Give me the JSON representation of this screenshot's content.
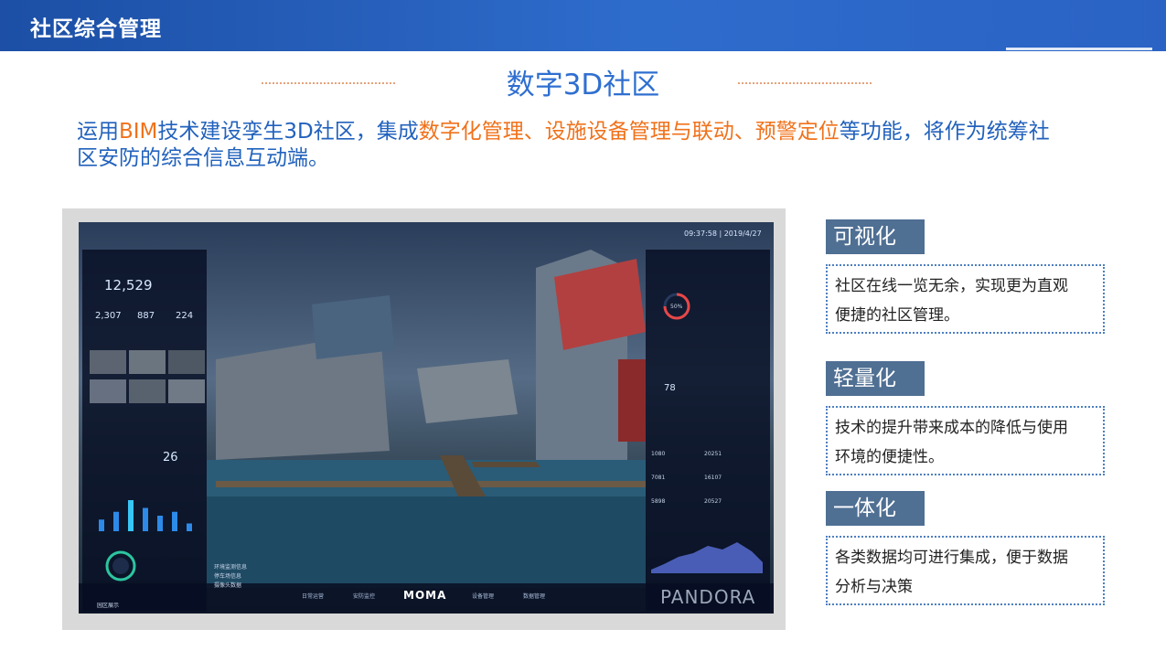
{
  "header": {
    "title": "社区综合管理"
  },
  "heading": "数字3D社区",
  "intro": {
    "parts": [
      {
        "text": "运用",
        "highlight": false
      },
      {
        "text": "BIM",
        "highlight": true
      },
      {
        "text": "技术建设孪生3D社区，集成",
        "highlight": false
      },
      {
        "text": "数字化管理、设施设备管理与联动、预警定位",
        "highlight": true
      },
      {
        "text": "等功能，将作为统筹社区安防的综合信息互动端。",
        "highlight": false
      }
    ],
    "line1_a": "运用",
    "line1_b": "BIM",
    "line1_c": "技术建设孪生3D社区，集成",
    "line1_d": "数字化管理、设施设备管理与联动、预警定位",
    "line1_e": "等功能，将作为统筹社",
    "line2": "区安防的综合信息互动端。"
  },
  "screenshot": {
    "time": "09:37:58  |  2019/4/27",
    "people_count": "12,529",
    "stat_a": "2,307",
    "stat_b": "887",
    "stat_c": "224",
    "visitor_count": "26",
    "humidity_label": "50%",
    "device_count": "78",
    "pandora": "PANDORA",
    "moma": "MOMA",
    "nav": [
      "日常运营",
      "安防监控",
      "设备管理",
      "数据管理"
    ],
    "legend": [
      "环境监测信息",
      "停车场信息",
      "摄像头数据"
    ],
    "bottom_left": "园区展示",
    "energy_values": [
      "1080",
      "20251",
      "7081",
      "16107",
      "5898",
      "20527"
    ],
    "chart_bars": [
      3,
      5,
      8,
      6,
      4,
      5,
      2
    ]
  },
  "features": [
    {
      "title": "可视化",
      "desc1": "社区在线一览无余，实现更为直观",
      "desc2": "便捷的社区管理。"
    },
    {
      "title": "轻量化",
      "desc1": "技术的提升带来成本的降低与使用",
      "desc2": "环境的便捷性。"
    },
    {
      "title": "一体化",
      "desc1": "各类数据均可进行集成，便于数据",
      "desc2": "分析与决策"
    }
  ],
  "colors": {
    "accent_blue": "#2f6fd0",
    "highlight_orange": "#f0721b",
    "header_blue": "#1c4fa5",
    "feature_title_bg": "#4f6f93"
  }
}
